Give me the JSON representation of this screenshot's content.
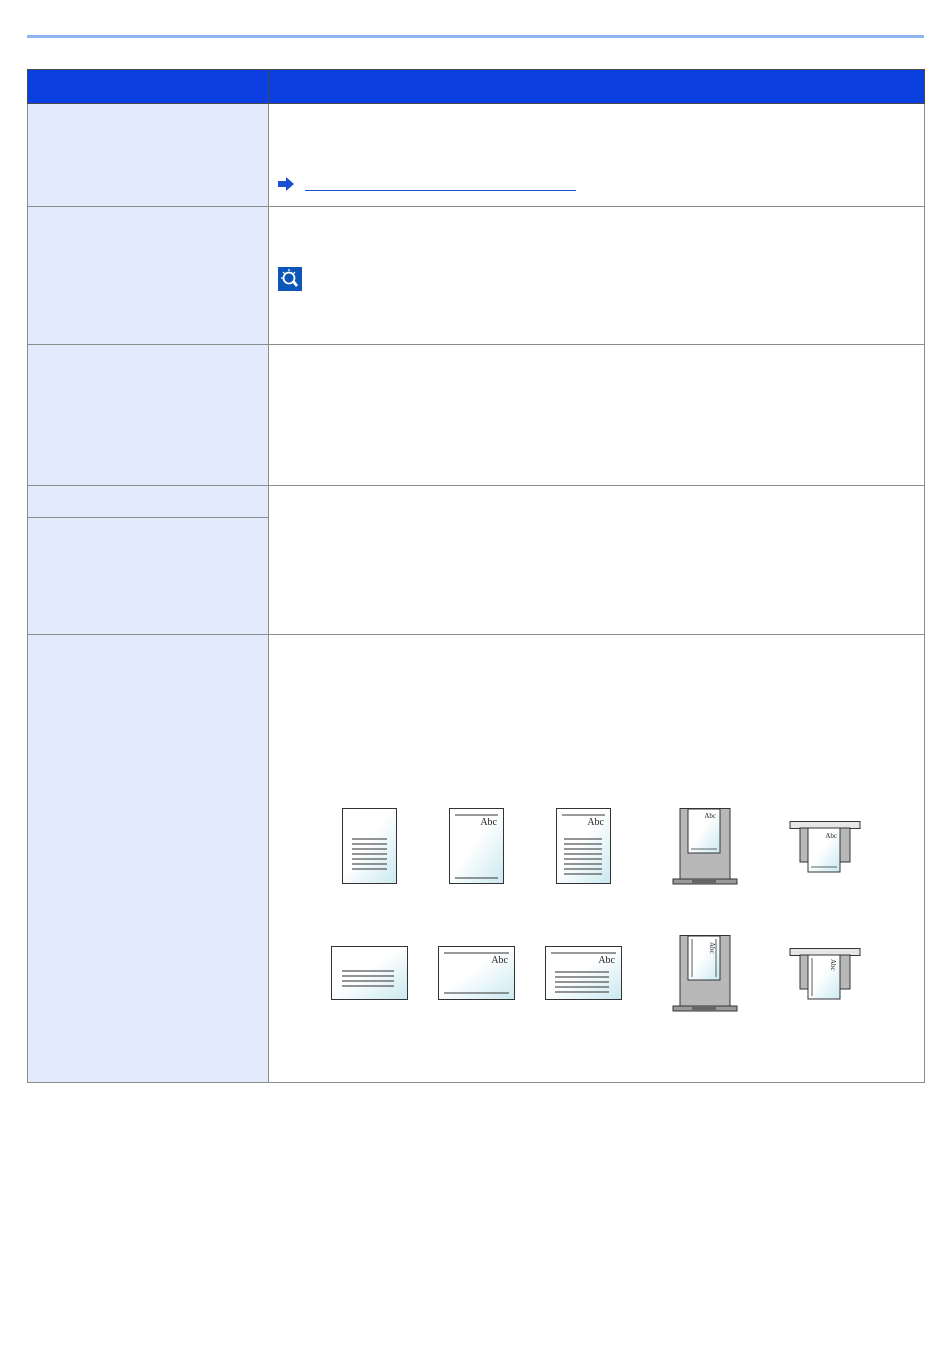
{
  "header": {
    "col_item": "",
    "col_description": ""
  },
  "rows": [
    {
      "item": "",
      "description": "",
      "link_text": ""
    },
    {
      "item": "",
      "description": "",
      "tip_text": ""
    },
    {
      "item": "",
      "description": ""
    },
    {
      "item": "",
      "description": ""
    },
    {
      "item": "",
      "description": ""
    },
    {
      "item": "",
      "description": ""
    }
  ],
  "figures": {
    "sample_text": "Abc",
    "icons": {
      "link_arrow": "arrow-right-icon",
      "tip": "lightbulb-icon"
    },
    "colors": {
      "header_blue": "#0b3fe0",
      "row_tint": "#e3eafb",
      "link_blue": "#1a4fd0",
      "rule_blue": "#8fb3ec",
      "paper_tint": "#d7eef4",
      "tray_gray": "#b8b8b8"
    }
  }
}
